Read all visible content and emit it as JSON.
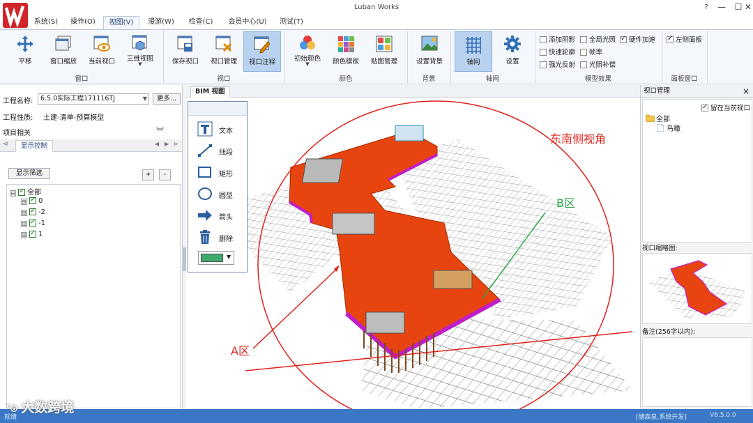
{
  "app": {
    "title": "Luban Works"
  },
  "window_controls": {
    "min": "—",
    "max": "☐",
    "close": "✕",
    "help": "?"
  },
  "menu": [
    "系统(S)",
    "操作(O)",
    "视图(V)",
    "漫游(W)",
    "检查(C)",
    "会员中心(U)",
    "测试(T)"
  ],
  "ribbon": {
    "buttons": [
      "平移",
      "窗口缩放",
      "当前视口",
      "三维视图",
      "保存视口",
      "视口管理",
      "视口注释",
      "初始颜色",
      "颜色模板",
      "贴图管理",
      "设置背景",
      "轴网",
      "设置"
    ],
    "groups": [
      "窗口",
      "视口",
      "颜色",
      "背景",
      "轴网",
      "模型效果",
      "面板窗口"
    ],
    "checkboxes": [
      {
        "label": "添加阴影",
        "checked": false
      },
      {
        "label": "全局光照",
        "checked": false
      },
      {
        "label": "硬件加速",
        "checked": true
      },
      {
        "label": "快速轮廓",
        "checked": false
      },
      {
        "label": "帧率",
        "checked": false
      },
      {
        "label": "强光反射",
        "checked": false
      },
      {
        "label": "光照补偿",
        "checked": false
      }
    ],
    "panel_check": {
      "label": "左侧面板",
      "checked": true
    }
  },
  "left": {
    "project_name_label": "工程名称:",
    "project_name_value": "6.5.0实际工程171116TJ",
    "more_button": "更多...",
    "project_type_label": "工程性质:",
    "project_type_value": "土建-清单-预算模型",
    "related_label": "项目相关",
    "collapse_icon": "︾",
    "tab": "显示控制",
    "nav_arrows": [
      "◀",
      "▶",
      "⊳"
    ],
    "first_arrow": "⊲",
    "filter_button": "显示筛选",
    "plus": "+",
    "minus": "-",
    "tree": [
      {
        "label": "全部",
        "expander": "⊟"
      },
      {
        "label": "0",
        "expander": "⊞"
      },
      {
        "label": "-2",
        "expander": "⊞"
      },
      {
        "label": "-1",
        "expander": "⊞"
      },
      {
        "label": "1",
        "expander": "⊞"
      }
    ]
  },
  "viewport": {
    "tab": "BIM 视图",
    "annotation_tools": [
      "文本",
      "线段",
      "矩形",
      "圆型",
      "箭头",
      "删除"
    ],
    "annotation_color": "#3daa6a",
    "labels": {
      "view_angle": "东南侧视角",
      "zone_a": "A区",
      "zone_b": "B区"
    },
    "red_color": "#e0201b",
    "green_color": "#2ea84a"
  },
  "right": {
    "title": "视口管理",
    "close": "×",
    "stay_label": "留在当前视口",
    "stay_checked": true,
    "tree": [
      {
        "label": "全部"
      },
      {
        "label": "鸟瞰"
      }
    ],
    "thumb_label": "视口缩略图:",
    "notes_label": "备注(256字以内):"
  },
  "status": {
    "left": "就绪",
    "user": "[储森泉,系统开发]",
    "version": "V6.5.0.0"
  },
  "watermark": "大数跨境"
}
